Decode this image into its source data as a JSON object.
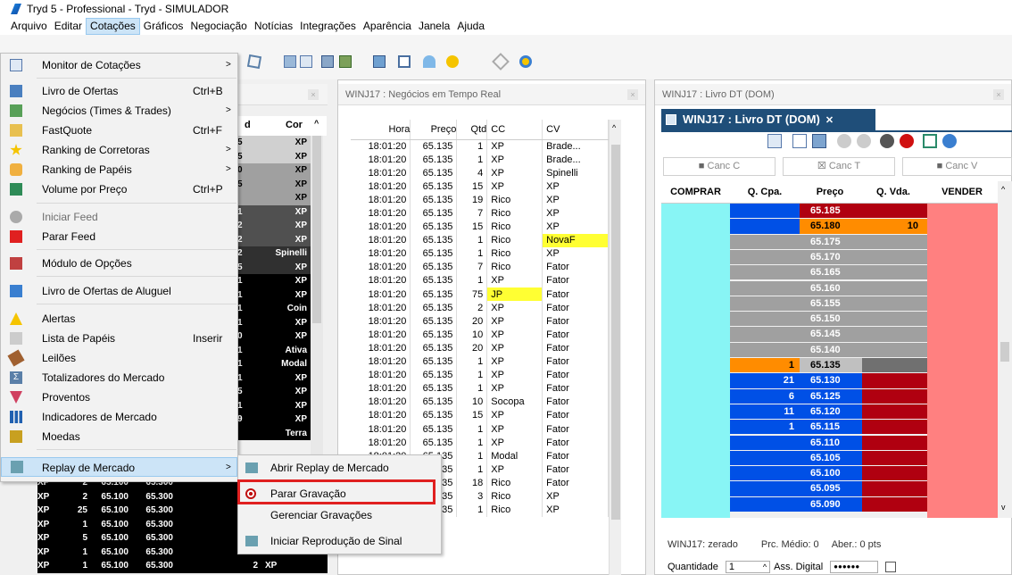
{
  "window": {
    "title": "Tryd 5 - Professional - Tryd - SIMULADOR"
  },
  "menubar": [
    "Arquivo",
    "Editar",
    "Cotações",
    "Gráficos",
    "Negociação",
    "Notícias",
    "Integrações",
    "Aparência",
    "Janela",
    "Ajuda"
  ],
  "menu": {
    "monitor": "Monitor de Cotações",
    "livro": "Livro de Ofertas",
    "livro_sc": "Ctrl+B",
    "negocios": "Negócios (Times & Trades)",
    "fastquote": "FastQuote",
    "fastquote_sc": "Ctrl+F",
    "rank_corr": "Ranking de Corretoras",
    "rank_pap": "Ranking de Papéis",
    "volume": "Volume por Preço",
    "volume_sc": "Ctrl+P",
    "iniciar_feed": "Iniciar Feed",
    "parar_feed": "Parar Feed",
    "opcoes": "Módulo de Opções",
    "aluguel": "Livro de Ofertas de Aluguel",
    "alertas": "Alertas",
    "lista": "Lista de Papéis",
    "lista_sc": "Inserir",
    "leiloes": "Leilões",
    "totalizadores": "Totalizadores do Mercado",
    "proventos": "Proventos",
    "indicadores": "Indicadores de Mercado",
    "moedas": "Moedas",
    "replay": "Replay de Mercado"
  },
  "submenu": {
    "abrir": "Abrir Replay de Mercado",
    "parar": "Parar Gravação",
    "gerenciar": "Gerenciar Gravações",
    "iniciar": "Iniciar Reprodução de Sinal"
  },
  "coin_panel": {
    "col_d": "d",
    "col_cor": "Cor",
    "rows": [
      {
        "d": "5",
        "cor": "XP",
        "bg": "#d0d0d0",
        "fg": "#000"
      },
      {
        "d": "5",
        "cor": "XP",
        "bg": "#d0d0d0",
        "fg": "#000"
      },
      {
        "d": "0",
        "cor": "XP",
        "bg": "#a0a0a0",
        "fg": "#000"
      },
      {
        "d": "5",
        "cor": "XP",
        "bg": "#a0a0a0",
        "fg": "#000"
      },
      {
        "d": "",
        "cor": "XP",
        "bg": "#a0a0a0",
        "fg": "#000"
      },
      {
        "d": "1",
        "cor": "XP",
        "bg": "#505050",
        "fg": "#fff"
      },
      {
        "d": "2",
        "cor": "XP",
        "bg": "#505050",
        "fg": "#fff"
      },
      {
        "d": "2",
        "cor": "XP",
        "bg": "#505050",
        "fg": "#fff"
      },
      {
        "d": "2",
        "cor": "Spinelli",
        "bg": "#303030",
        "fg": "#fff"
      },
      {
        "d": "5",
        "cor": "XP",
        "bg": "#303030",
        "fg": "#fff"
      },
      {
        "d": "1",
        "cor": "XP",
        "bg": "#000",
        "fg": "#fff"
      },
      {
        "d": "1",
        "cor": "XP",
        "bg": "#000",
        "fg": "#fff"
      },
      {
        "d": "1",
        "cor": "Coin",
        "bg": "#000",
        "fg": "#fff"
      },
      {
        "d": "1",
        "cor": "XP",
        "bg": "#000",
        "fg": "#fff"
      },
      {
        "d": "0",
        "cor": "XP",
        "bg": "#000",
        "fg": "#fff"
      },
      {
        "d": "1",
        "cor": "Ativa",
        "bg": "#000",
        "fg": "#fff"
      },
      {
        "d": "1",
        "cor": "Modal",
        "bg": "#000",
        "fg": "#fff"
      },
      {
        "d": "1",
        "cor": "XP",
        "bg": "#000",
        "fg": "#fff"
      },
      {
        "d": "5",
        "cor": "XP",
        "bg": "#000",
        "fg": "#fff"
      },
      {
        "d": "1",
        "cor": "XP",
        "bg": "#000",
        "fg": "#fff"
      },
      {
        "d": "9",
        "cor": "XP",
        "bg": "#000",
        "fg": "#fff"
      },
      {
        "d": "",
        "cor": "Terra",
        "bg": "#000",
        "fg": "#fff"
      }
    ],
    "bottom_rows": [
      [
        "XP",
        "2",
        "65.100",
        "65.300",
        "",
        ""
      ],
      [
        "XP",
        "2",
        "65.100",
        "65.300",
        "",
        ""
      ],
      [
        "XP",
        "25",
        "65.100",
        "65.300",
        "",
        ""
      ],
      [
        "XP",
        "1",
        "65.100",
        "65.300",
        "",
        ""
      ],
      [
        "XP",
        "5",
        "65.100",
        "65.300",
        "",
        ""
      ],
      [
        "XP",
        "1",
        "65.100",
        "65.300",
        "1",
        "XP"
      ],
      [
        "XP",
        "1",
        "65.100",
        "65.300",
        "2",
        "XP"
      ]
    ]
  },
  "tt_panel": {
    "header": "WINJ17 : Negócios em Tempo Real",
    "columns": [
      "Hora",
      "Preço",
      "Qtd",
      "CC",
      "CV"
    ],
    "rows": [
      [
        "18:01:20",
        "65.135",
        "1",
        "XP",
        "Brade...",
        "",
        ""
      ],
      [
        "18:01:20",
        "65.135",
        "1",
        "XP",
        "Brade...",
        "",
        ""
      ],
      [
        "18:01:20",
        "65.135",
        "4",
        "XP",
        "Spinelli",
        "",
        ""
      ],
      [
        "18:01:20",
        "65.135",
        "15",
        "XP",
        "XP",
        "",
        ""
      ],
      [
        "18:01:20",
        "65.135",
        "19",
        "Rico",
        "XP",
        "",
        ""
      ],
      [
        "18:01:20",
        "65.135",
        "7",
        "Rico",
        "XP",
        "",
        ""
      ],
      [
        "18:01:20",
        "65.135",
        "15",
        "Rico",
        "XP",
        "",
        ""
      ],
      [
        "18:01:20",
        "65.135",
        "1",
        "Rico",
        "NovaF",
        "",
        "hl"
      ],
      [
        "18:01:20",
        "65.135",
        "1",
        "Rico",
        "XP",
        "",
        ""
      ],
      [
        "18:01:20",
        "65.135",
        "7",
        "Rico",
        "Fator",
        "",
        ""
      ],
      [
        "18:01:20",
        "65.135",
        "1",
        "XP",
        "Fator",
        "",
        ""
      ],
      [
        "18:01:20",
        "65.135",
        "75",
        "JP",
        "Fator",
        "hl",
        ""
      ],
      [
        "18:01:20",
        "65.135",
        "2",
        "XP",
        "Fator",
        "",
        ""
      ],
      [
        "18:01:20",
        "65.135",
        "20",
        "XP",
        "Fator",
        "",
        ""
      ],
      [
        "18:01:20",
        "65.135",
        "10",
        "XP",
        "Fator",
        "",
        ""
      ],
      [
        "18:01:20",
        "65.135",
        "20",
        "XP",
        "Fator",
        "",
        ""
      ],
      [
        "18:01:20",
        "65.135",
        "1",
        "XP",
        "Fator",
        "",
        ""
      ],
      [
        "18:01:20",
        "65.135",
        "1",
        "XP",
        "Fator",
        "",
        ""
      ],
      [
        "18:01:20",
        "65.135",
        "1",
        "XP",
        "Fator",
        "",
        ""
      ],
      [
        "18:01:20",
        "65.135",
        "10",
        "Socopa",
        "Fator",
        "",
        ""
      ],
      [
        "18:01:20",
        "65.135",
        "15",
        "XP",
        "Fator",
        "",
        ""
      ],
      [
        "18:01:20",
        "65.135",
        "1",
        "XP",
        "Fator",
        "",
        ""
      ],
      [
        "18:01:20",
        "65.135",
        "1",
        "XP",
        "Fator",
        "",
        ""
      ],
      [
        "18:01:20",
        "65.135",
        "1",
        "Modal",
        "Fator",
        "",
        ""
      ],
      [
        "18:01:20",
        "65.135",
        "1",
        "XP",
        "Fator",
        "",
        ""
      ],
      [
        "18:01:20",
        "65.135",
        "18",
        "Rico",
        "Fator",
        "",
        ""
      ],
      [
        "18:01:20",
        "65.135",
        "3",
        "Rico",
        "XP",
        "",
        ""
      ],
      [
        "18:01:20",
        "65.135",
        "1",
        "Rico",
        "XP",
        "",
        ""
      ]
    ]
  },
  "dom_panel": {
    "header": "WINJ17 : Livro DT (DOM)",
    "tab": "WINJ17 : Livro DT (DOM)",
    "canc_c": "Canc C",
    "canc_t": "Canc T",
    "canc_v": "Canc V",
    "columns": [
      "COMPRAR",
      "Q. Cpa.",
      "Preço",
      "Q. Vda.",
      "VENDER"
    ],
    "prices": [
      "65.185",
      "65.180",
      "65.175",
      "65.170",
      "65.165",
      "65.160",
      "65.155",
      "65.150",
      "65.145",
      "65.140",
      "65.135",
      "65.130",
      "65.125",
      "65.120",
      "65.115",
      "65.110",
      "65.105",
      "65.100",
      "65.095",
      "65.090"
    ],
    "qcpa": [
      "",
      "",
      "",
      "",
      "",
      "",
      "",
      "",
      "",
      "",
      "1",
      "21",
      "6",
      "11",
      "1",
      "",
      "",
      "",
      "",
      ""
    ],
    "qvda": [
      "",
      "10",
      "",
      "",
      "",
      "",
      "",
      "",
      "",
      "",
      "",
      "",
      "",
      "",
      "",
      "",
      "",
      "",
      "",
      ""
    ],
    "status_zerado": "WINJ17: zerado",
    "status_medio": "Prc. Médio: 0",
    "status_aber": "Aber.: 0 pts",
    "qty_label": "Quantidade",
    "qty_value": "1",
    "ass_digital": "Ass. Digital",
    "password": "●●●●●●"
  },
  "colors": {
    "accent": "#1f4e79",
    "buy": "#0050e6",
    "sell": "#b00010",
    "highlight": "#ffff33",
    "orange": "#ff8c00"
  }
}
